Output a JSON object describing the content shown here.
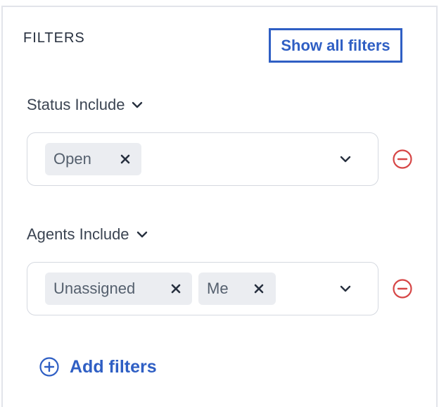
{
  "header": {
    "title": "FILTERS",
    "show_all_label": "Show all filters"
  },
  "status_filter": {
    "label": "Status Include",
    "tags": [
      "Open"
    ]
  },
  "agents_filter": {
    "label": "Agents Include",
    "tags": [
      "Unassigned",
      "Me"
    ]
  },
  "actions": {
    "add_filters_label": "Add filters"
  },
  "colors": {
    "accent": "#2f5fc4",
    "remove": "#d64545",
    "tag_bg": "#ebedf1",
    "border": "#d5d9e0"
  },
  "icons": [
    "chevron-down-icon",
    "close-icon",
    "remove-circle-icon",
    "add-circle-icon"
  ]
}
